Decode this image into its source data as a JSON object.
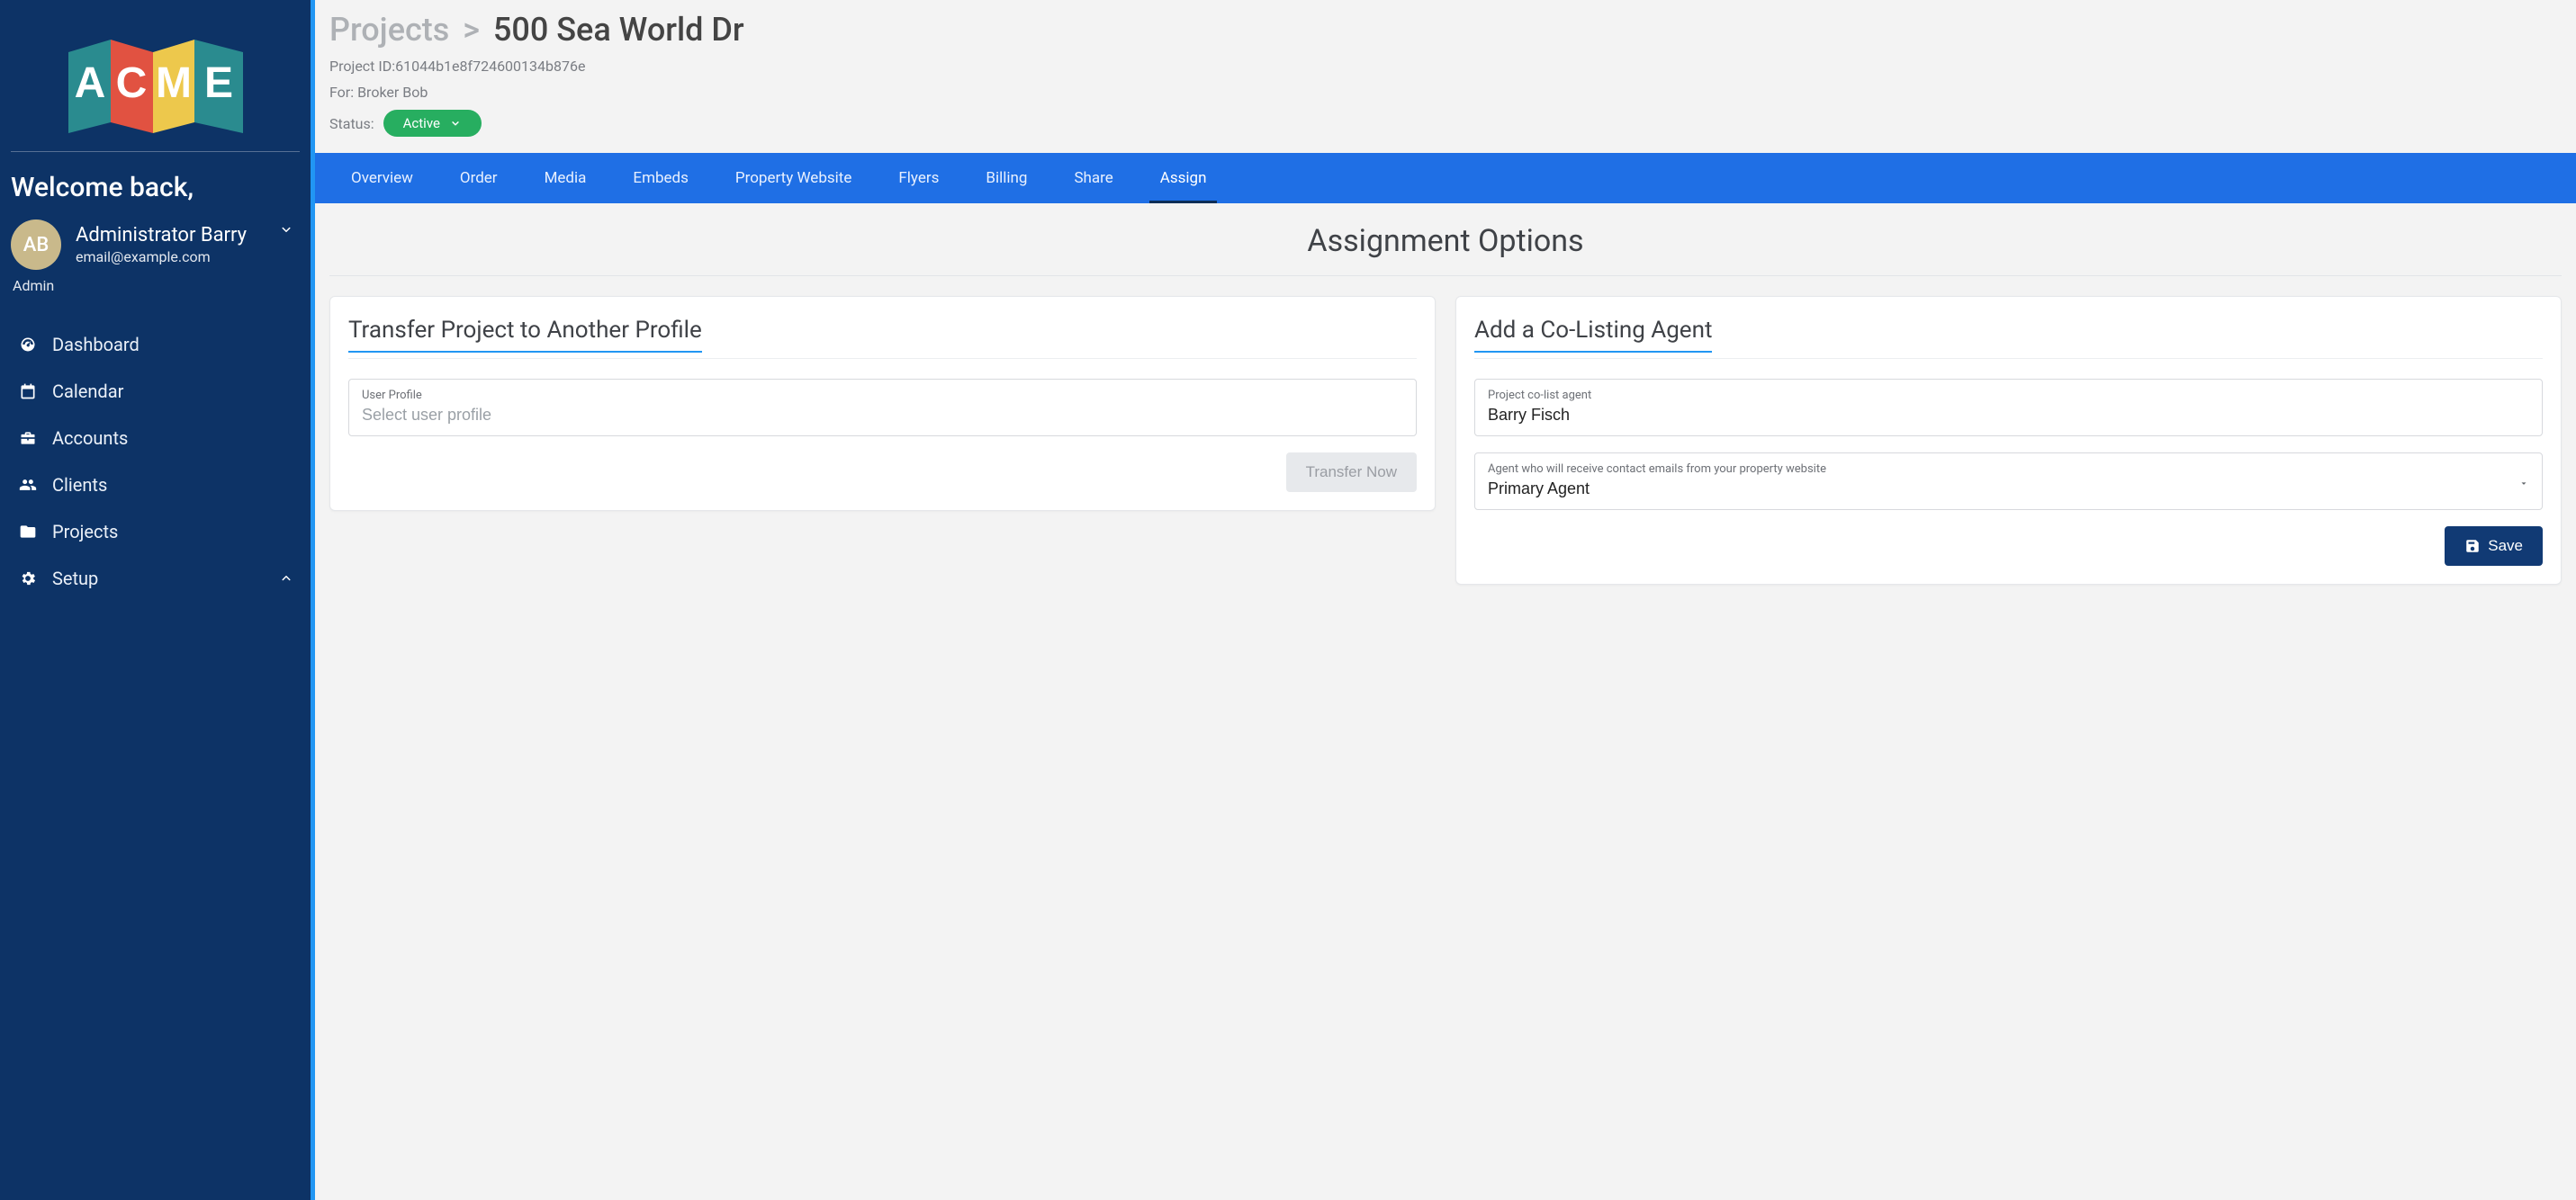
{
  "sidebar": {
    "welcome": "Welcome back,",
    "avatar_initials": "AB",
    "user_name": "Administrator Barry",
    "user_email": "email@example.com",
    "user_role": "Admin",
    "items": [
      {
        "label": "Dashboard"
      },
      {
        "label": "Calendar"
      },
      {
        "label": "Accounts"
      },
      {
        "label": "Clients"
      },
      {
        "label": "Projects"
      },
      {
        "label": "Setup"
      }
    ]
  },
  "header": {
    "breadcrumb_root": "Projects",
    "breadcrumb_sep": ">",
    "breadcrumb_current": "500 Sea World Dr",
    "project_id_label": "Project ID:",
    "project_id": "61044b1e8f724600134b876e",
    "for_label": "For: ",
    "for_value": "Broker Bob",
    "status_label": "Status:",
    "status_value": "Active"
  },
  "tabs": [
    {
      "label": "Overview"
    },
    {
      "label": "Order"
    },
    {
      "label": "Media"
    },
    {
      "label": "Embeds"
    },
    {
      "label": "Property Website"
    },
    {
      "label": "Flyers"
    },
    {
      "label": "Billing"
    },
    {
      "label": "Share"
    },
    {
      "label": "Assign",
      "active": true
    }
  ],
  "content": {
    "section_title": "Assignment Options",
    "transfer": {
      "title": "Transfer Project to Another Profile",
      "field_label": "User Profile",
      "placeholder": "Select user profile",
      "button": "Transfer Now"
    },
    "colist": {
      "title": "Add a Co-Listing Agent",
      "agent_field_label": "Project co-list agent",
      "agent_value": "Barry Fisch",
      "contact_field_label": "Agent who will receive contact emails from your property website",
      "contact_value": "Primary Agent",
      "save_button": "Save"
    }
  }
}
